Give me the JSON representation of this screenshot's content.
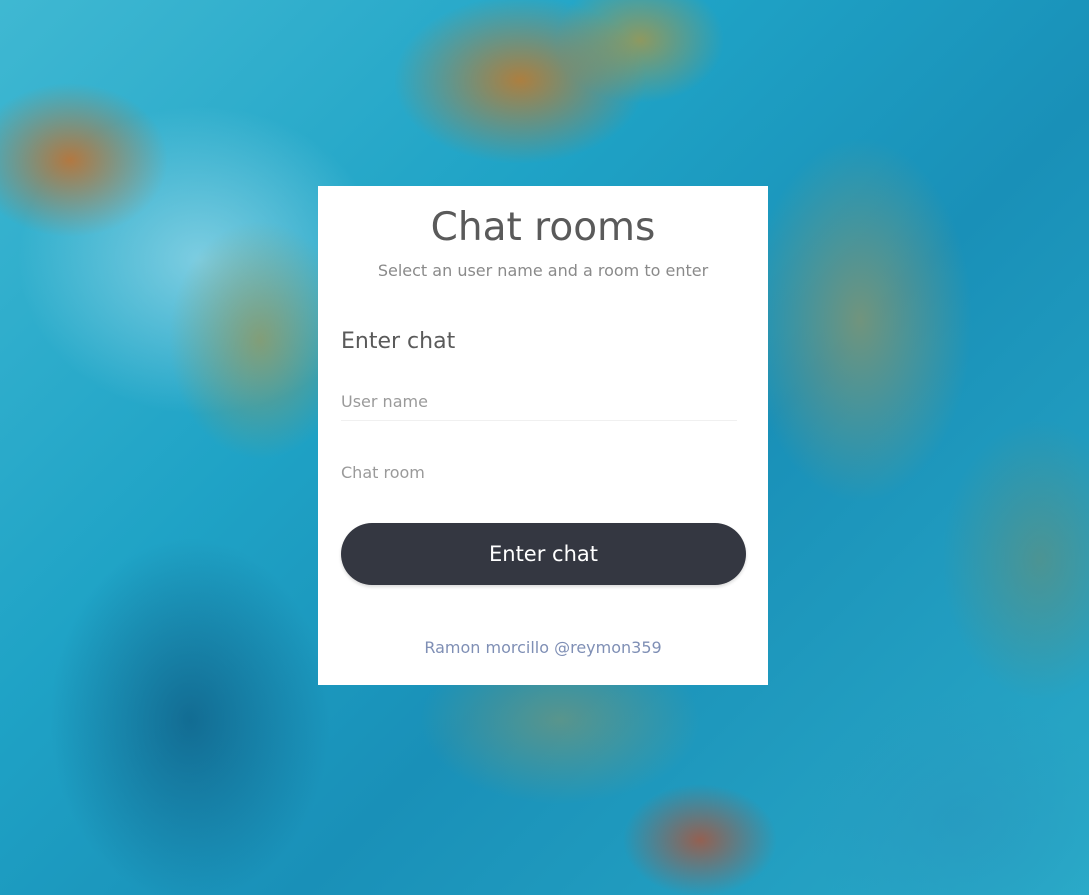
{
  "header": {
    "title": "Chat rooms",
    "subtitle": "Select an user name and a room to enter"
  },
  "form": {
    "section_title": "Enter chat",
    "user_name": {
      "value": "",
      "placeholder": "User name"
    },
    "chat_room": {
      "value": "",
      "placeholder": "Chat room"
    },
    "submit_label": "Enter chat"
  },
  "footer": {
    "credit": "Ramon morcillo @reymon359"
  },
  "colors": {
    "card_background": "#ffffff",
    "button_background": "#343741",
    "button_text": "#ffffff",
    "credit_link": "#7f8fb5",
    "ocean": "#1fa3c6"
  }
}
